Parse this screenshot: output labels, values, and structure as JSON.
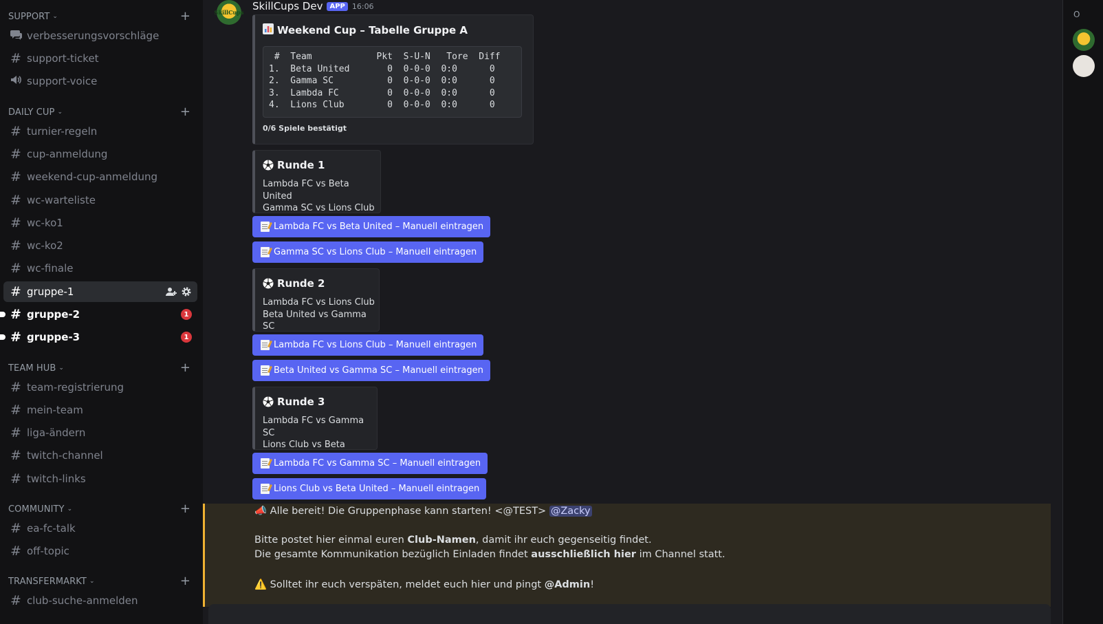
{
  "sidebar": {
    "categories": {
      "support": "SUPPORT",
      "daily_cup": "DAILY CUP",
      "team_hub": "TEAM HUB",
      "community": "COMMUNITY",
      "transfermarkt": "TRANSFERMARKT"
    },
    "channels": {
      "verbesserungsvorschlaege": "verbesserungsvorschläge",
      "support_ticket": "support-ticket",
      "support_voice": "support-voice",
      "turnier_regeln": "turnier-regeln",
      "cup_anmeldung": "cup-anmeldung",
      "weekend_cup_anmeldung": "weekend-cup-anmeldung",
      "wc_warteliste": "wc-warteliste",
      "wc_ko1": "wc-ko1",
      "wc_ko2": "wc-ko2",
      "wc_finale": "wc-finale",
      "gruppe_1": "gruppe-1",
      "gruppe_2": "gruppe-2",
      "gruppe_3": "gruppe-3",
      "team_registrierung": "team-registrierung",
      "mein_team": "mein-team",
      "liga_aendern": "liga-ändern",
      "twitch_channel": "twitch-channel",
      "twitch_links": "twitch-links",
      "ea_fc_talk": "ea-fc-talk",
      "off_topic": "off-topic",
      "club_suche_anmelden": "club-suche-anmelden"
    },
    "badges": {
      "gruppe_2": "1",
      "gruppe_3": "1"
    }
  },
  "message": {
    "author": "SkillCups Dev",
    "app_tag": "APP",
    "time": "16:06",
    "avatar_text": "SkillCups",
    "table_embed": {
      "title": "Weekend Cup – Tabelle Gruppe A",
      "code": " #  Team            Pkt  S-U-N   Tore  Diff\n1.  Beta United       0  0-0-0  0:0      0\n2.  Gamma SC          0  0-0-0  0:0      0\n3.  Lambda FC         0  0-0-0  0:0      0\n4.  Lions Club        0  0-0-0  0:0      0",
      "footer": "0/6 Spiele bestätigt"
    },
    "rounds": [
      {
        "title": "Runde 1",
        "line1": "Lambda FC vs Beta United",
        "line2": "Gamma SC vs Lions Club",
        "buttons": [
          "Lambda FC vs Beta United – Manuell eintragen",
          "Gamma SC vs Lions Club – Manuell eintragen"
        ]
      },
      {
        "title": "Runde 2",
        "line1": "Lambda FC vs Lions Club",
        "line2": "Beta United vs Gamma SC",
        "buttons": [
          "Lambda FC vs Lions Club – Manuell eintragen",
          "Beta United vs Gamma SC – Manuell eintragen"
        ]
      },
      {
        "title": "Runde 3",
        "line1": "Lambda FC vs Gamma SC",
        "line2": "Lions Club vs Beta United",
        "buttons": [
          "Lambda FC vs Gamma SC – Manuell eintragen",
          "Lions Club vs Beta United – Manuell eintragen"
        ]
      }
    ]
  },
  "announcement": {
    "line1_text": "Alle bereit! Die Gruppenphase kann starten! <@TEST>",
    "line1_mention": "@Zacky",
    "line2_pre": "Bitte postet hier einmal euren ",
    "line2_bold": "Club-Namen",
    "line2_post": ", damit ihr euch gegenseitig findet.",
    "line3_pre": "Die gesamte Kommunikation bezüglich Einladen findet ",
    "line3_bold": "ausschließlich hier",
    "line3_post": " im Channel statt.",
    "line4_pre": "Solltet ihr euch verspäten, meldet euch hier und pingt ",
    "line4_bold": "@Admin",
    "line4_post": "!"
  },
  "members": {
    "header_letter": "O"
  },
  "colors": {
    "blurple": "#5865f2",
    "highlight": "#f0b232",
    "badge": "#da373c"
  }
}
